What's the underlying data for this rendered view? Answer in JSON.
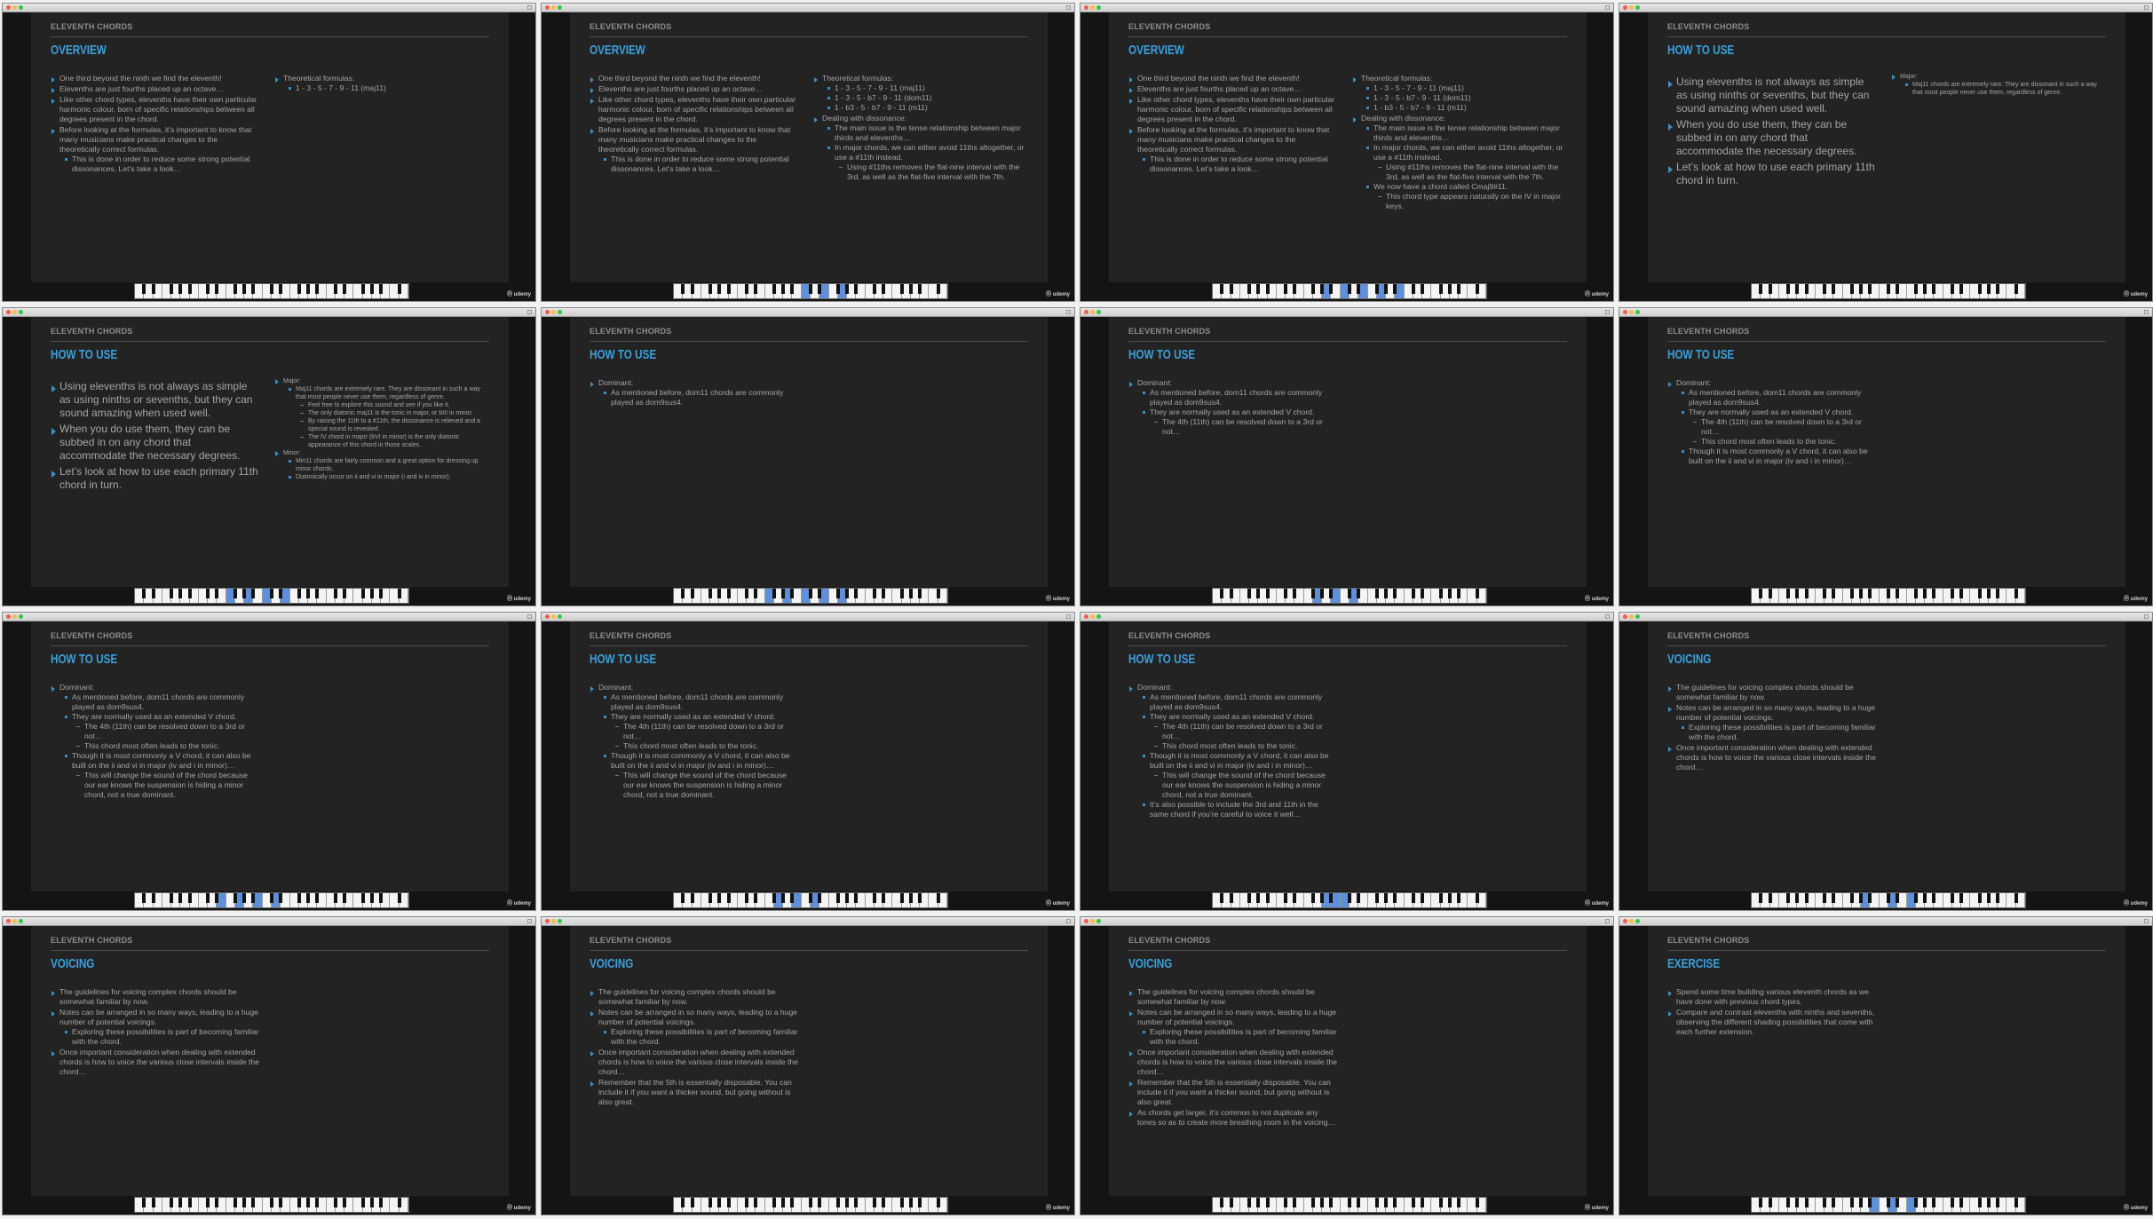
{
  "logo_text": "Ⓞ udemy",
  "frames": [
    {
      "title": "ELEVENTH CHORDS",
      "heading": "OVERVIEW",
      "left_size": "s",
      "right_size": "s",
      "left": [
        {
          "level": 0,
          "text": "One third beyond the ninth we find the eleventh!"
        },
        {
          "level": 0,
          "text": "Elevenths are just fourths placed up an octave…"
        },
        {
          "level": 0,
          "text": "Like other chord types, elevenths have their own particular harmonic colour, born of specific relationships between all degrees present in the chord."
        },
        {
          "level": 0,
          "text": "Before looking at the formulas, it’s important to know that many musicians make practical changes to the theoretically correct formulas."
        },
        {
          "level": 1,
          "text": "This is done in order to reduce some strong potential dissonances. Let’s take a look…"
        }
      ],
      "right": [
        {
          "level": 0,
          "text": "Theoretical formulas:"
        },
        {
          "level": 1,
          "text": "1 - 3 - 5 - 7 - 9 - 11 (maj11)"
        }
      ],
      "keys": []
    },
    {
      "title": "ELEVENTH CHORDS",
      "heading": "OVERVIEW",
      "left_size": "s",
      "right_size": "s",
      "left": [
        {
          "level": 0,
          "text": "One third beyond the ninth we find the eleventh!"
        },
        {
          "level": 0,
          "text": "Elevenths are just fourths placed up an octave…"
        },
        {
          "level": 0,
          "text": "Like other chord types, elevenths have their own particular harmonic colour, born of specific relationships between all degrees present in the chord."
        },
        {
          "level": 0,
          "text": "Before looking at the formulas, it’s important to know that many musicians make practical changes to the theoretically correct formulas."
        },
        {
          "level": 1,
          "text": "This is done in order to reduce some strong potential dissonances. Let’s take a look…"
        }
      ],
      "right": [
        {
          "level": 0,
          "text": "Theoretical formulas:"
        },
        {
          "level": 1,
          "text": "1 - 3 - 5 - 7 - 9 - 11 (maj11)"
        },
        {
          "level": 1,
          "text": "1 - 3 - 5 - b7 - 9 - 11 (dom11)"
        },
        {
          "level": 1,
          "text": "1 - b3 - 5 - b7 - 9 - 11 (m11)"
        },
        {
          "level": 0,
          "text": "Dealing with dissonance:"
        },
        {
          "level": 1,
          "text": "The main issue is the tense relationship between major thirds and elevenths…"
        },
        {
          "level": 1,
          "text": "In major chords, we can either avoid 11ths altogether, or use a #11th instead."
        },
        {
          "level": 2,
          "text": "Using #11ths removes the flat-nine interval with the 3rd, as well as the flat-five interval with the 7th."
        }
      ],
      "keys": [
        14,
        16,
        18
      ]
    },
    {
      "title": "ELEVENTH CHORDS",
      "heading": "OVERVIEW",
      "left_size": "s",
      "right_size": "s",
      "left": [
        {
          "level": 0,
          "text": "One third beyond the ninth we find the eleventh!"
        },
        {
          "level": 0,
          "text": "Elevenths are just fourths placed up an octave…"
        },
        {
          "level": 0,
          "text": "Like other chord types, elevenths have their own particular harmonic colour, born of specific relationships between all degrees present in the chord."
        },
        {
          "level": 0,
          "text": "Before looking at the formulas, it’s important to know that many musicians make practical changes to the theoretically correct formulas."
        },
        {
          "level": 1,
          "text": "This is done in order to reduce some strong potential dissonances. Let’s take a look…"
        }
      ],
      "right": [
        {
          "level": 0,
          "text": "Theoretical formulas:"
        },
        {
          "level": 1,
          "text": "1 - 3 - 5 - 7 - 9 - 11 (maj11)"
        },
        {
          "level": 1,
          "text": "1 - 3 - 5 - b7 - 9 - 11 (dom11)"
        },
        {
          "level": 1,
          "text": "1 - b3 - 5 - b7 - 9 - 11 (m11)"
        },
        {
          "level": 0,
          "text": "Dealing with dissonance:"
        },
        {
          "level": 1,
          "text": "The main issue is the tense relationship between major thirds and elevenths…"
        },
        {
          "level": 1,
          "text": "In major chords, we can either avoid 11ths altogether, or use a #11th instead."
        },
        {
          "level": 2,
          "text": "Using #11ths removes the flat-nine interval with the 3rd, as well as the flat-five interval with the 7th."
        },
        {
          "level": 1,
          "text": "We now have a chord called Cmaj9#11."
        },
        {
          "level": 2,
          "text": "This chord type appears naturally on the IV in major keys."
        }
      ],
      "keys": [
        12,
        14,
        16,
        18,
        20
      ]
    },
    {
      "title": "ELEVENTH CHORDS",
      "heading": "HOW TO USE",
      "left_size": "l",
      "right_size": "xs",
      "left": [
        {
          "level": 0,
          "text": "Using elevenths is not always as simple as using ninths or sevenths, but they can sound amazing when used well."
        },
        {
          "level": 0,
          "text": "When you do use them, they can be subbed in on any chord that accommodate the necessary degrees."
        },
        {
          "level": 0,
          "text": "Let’s look at how to use each primary 11th chord in turn."
        }
      ],
      "right": [
        {
          "level": 0,
          "text": "Major:"
        },
        {
          "level": 1,
          "text": "Maj11 chords are extremely rare. They are dissonant in such a way that most people never use them, regardless of genre."
        }
      ],
      "keys": []
    },
    {
      "title": "ELEVENTH CHORDS",
      "heading": "HOW TO USE",
      "left_size": "l",
      "right_size": "xs",
      "left": [
        {
          "level": 0,
          "text": "Using elevenths is not always as simple as using ninths or sevenths, but they can sound amazing when used well."
        },
        {
          "level": 0,
          "text": "When you do use them, they can be subbed in on any chord that accommodate the necessary degrees."
        },
        {
          "level": 0,
          "text": "Let’s look at how to use each primary 11th chord in turn."
        }
      ],
      "right": [
        {
          "level": 0,
          "text": "Major:"
        },
        {
          "level": 1,
          "text": "Maj11 chords are extremely rare. They are dissonant in such a way that most people never use them, regardless of genre."
        },
        {
          "level": 2,
          "text": "Feel free to explore this sound and see if you like it."
        },
        {
          "level": 2,
          "text": "The only diatonic maj11 is the tonic in major, or bIII in minor."
        },
        {
          "level": 2,
          "text": "By raising the 11th to a #11th, the dissonance is relieved and a special sound is revealed."
        },
        {
          "level": 2,
          "text": "The IV chord in major (bVI in minor) is the only diatonic appearance of this chord in those scales."
        },
        {
          "level": 0,
          "text": "Minor:"
        },
        {
          "level": 1,
          "text": "Min11 chords are fairly common and a great option for dressing up minor chords."
        },
        {
          "level": 1,
          "text": "Diatonically occur on ii and vi in major (i and iv in minor)."
        }
      ],
      "keys": [
        10,
        12,
        14,
        16
      ]
    },
    {
      "title": "ELEVENTH CHORDS",
      "heading": "HOW TO USE",
      "left_size": "s",
      "right_size": "s",
      "left": [
        {
          "level": 0,
          "text": "Dominant:"
        },
        {
          "level": 1,
          "text": "As mentioned before, dom11 chords are commonly played as dom9sus4."
        }
      ],
      "right": [],
      "keys": [
        10,
        12,
        14,
        16,
        18
      ]
    },
    {
      "title": "ELEVENTH CHORDS",
      "heading": "HOW TO USE",
      "left_size": "s",
      "right_size": "s",
      "left": [
        {
          "level": 0,
          "text": "Dominant:"
        },
        {
          "level": 1,
          "text": "As mentioned before, dom11 chords are commonly played as dom9sus4."
        },
        {
          "level": 1,
          "text": "They are normally used as an extended V chord."
        },
        {
          "level": 2,
          "text": "The 4th (11th) can be resolved down to a 3rd or not…"
        }
      ],
      "right": [],
      "keys": [
        11,
        13,
        15
      ]
    },
    {
      "title": "ELEVENTH CHORDS",
      "heading": "HOW TO USE",
      "left_size": "s",
      "right_size": "s",
      "left": [
        {
          "level": 0,
          "text": "Dominant:"
        },
        {
          "level": 1,
          "text": "As mentioned before, dom11 chords are commonly played as dom9sus4."
        },
        {
          "level": 1,
          "text": "They are normally used as an extended V chord."
        },
        {
          "level": 2,
          "text": "The 4th (11th) can be resolved down to a 3rd or not…"
        },
        {
          "level": 2,
          "text": "This chord most often leads to the tonic."
        },
        {
          "level": 1,
          "text": "Though it is most commonly a V chord, it can also be built on the ii and vi in major (iv and i in minor)…"
        }
      ],
      "right": [],
      "keys": []
    },
    {
      "title": "ELEVENTH CHORDS",
      "heading": "HOW TO USE",
      "left_size": "s",
      "right_size": "s",
      "left": [
        {
          "level": 0,
          "text": "Dominant:"
        },
        {
          "level": 1,
          "text": "As mentioned before, dom11 chords are commonly played as dom9sus4."
        },
        {
          "level": 1,
          "text": "They are normally used as an extended V chord."
        },
        {
          "level": 2,
          "text": "The 4th (11th) can be resolved down to a 3rd or not…"
        },
        {
          "level": 2,
          "text": "This chord most often leads to the tonic."
        },
        {
          "level": 1,
          "text": "Though it is most commonly a V chord, it can also be built on the ii and vi in major (iv and i in minor)…"
        },
        {
          "level": 2,
          "text": "This will change the sound of the chord because our ear knows the suspension is hiding a minor chord, not a true dominant."
        }
      ],
      "right": [],
      "keys": [
        9,
        11,
        13,
        15
      ]
    },
    {
      "title": "ELEVENTH CHORDS",
      "heading": "HOW TO USE",
      "left_size": "s",
      "right_size": "s",
      "left": [
        {
          "level": 0,
          "text": "Dominant:"
        },
        {
          "level": 1,
          "text": "As mentioned before, dom11 chords are commonly played as dom9sus4."
        },
        {
          "level": 1,
          "text": "They are normally used as an extended V chord."
        },
        {
          "level": 2,
          "text": "The 4th (11th) can be resolved down to a 3rd or not…"
        },
        {
          "level": 2,
          "text": "This chord most often leads to the tonic."
        },
        {
          "level": 1,
          "text": "Though it is most commonly a V chord, it can also be built on the ii and vi in major (iv and i in minor)…"
        },
        {
          "level": 2,
          "text": "This will change the sound of the chord because our ear knows the suspension is hiding a minor chord, not a true dominant."
        }
      ],
      "right": [],
      "keys": [
        11,
        13,
        15
      ]
    },
    {
      "title": "ELEVENTH CHORDS",
      "heading": "HOW TO USE",
      "left_size": "s",
      "right_size": "s",
      "left": [
        {
          "level": 0,
          "text": "Dominant:"
        },
        {
          "level": 1,
          "text": "As mentioned before, dom11 chords are commonly played as dom9sus4."
        },
        {
          "level": 1,
          "text": "They are normally used as an extended V chord."
        },
        {
          "level": 2,
          "text": "The 4th (11th) can be resolved down to a 3rd or not…"
        },
        {
          "level": 2,
          "text": "This chord most often leads to the tonic."
        },
        {
          "level": 1,
          "text": "Though it is most commonly a V chord, it can also be built on the ii and vi in major (iv and i in minor)…"
        },
        {
          "level": 2,
          "text": "This will change the sound of the chord because our ear knows the suspension is hiding a minor chord, not a true dominant."
        },
        {
          "level": 1,
          "text": "It’s also possible to include the 3rd and 11th in the same chord if you’re careful to voice it well…"
        }
      ],
      "right": [],
      "keys": [
        12,
        13,
        14
      ]
    },
    {
      "title": "ELEVENTH CHORDS",
      "heading": "VOICING",
      "left_size": "s",
      "right_size": "s",
      "left": [
        {
          "level": 0,
          "text": "The guidelines for voicing complex chords should be somewhat familiar by now."
        },
        {
          "level": 0,
          "text": "Notes can be arranged in so many ways, leading to a huge number of potential voicings."
        },
        {
          "level": 1,
          "text": "Exploring these possibilities is part of becoming familiar with the chord."
        },
        {
          "level": 0,
          "text": "Once important consideration when dealing with extended chords is how to voice the various close intervals inside the chord…"
        }
      ],
      "right": [],
      "keys": [
        12,
        15,
        17
      ]
    },
    {
      "title": "ELEVENTH CHORDS",
      "heading": "VOICING",
      "left_size": "s",
      "right_size": "s",
      "left": [
        {
          "level": 0,
          "text": "The guidelines for voicing complex chords should be somewhat familiar by now."
        },
        {
          "level": 0,
          "text": "Notes can be arranged in so many ways, leading to a huge number of potential voicings."
        },
        {
          "level": 1,
          "text": "Exploring these possibilities is part of becoming familiar with the chord."
        },
        {
          "level": 0,
          "text": "Once important consideration when dealing with extended chords is how to voice the various close intervals inside the chord…"
        }
      ],
      "right": [],
      "keys": []
    },
    {
      "title": "ELEVENTH CHORDS",
      "heading": "VOICING",
      "left_size": "s",
      "right_size": "s",
      "left": [
        {
          "level": 0,
          "text": "The guidelines for voicing complex chords should be somewhat familiar by now."
        },
        {
          "level": 0,
          "text": "Notes can be arranged in so many ways, leading to a huge number of potential voicings."
        },
        {
          "level": 1,
          "text": "Exploring these possibilities is part of becoming familiar with the chord."
        },
        {
          "level": 0,
          "text": "Once important consideration when dealing with extended chords is how to voice the various close intervals inside the chord…"
        },
        {
          "level": 0,
          "text": "Remember that the 5th is essentially disposable. You can include it if you want a thicker sound, but going without is also great."
        }
      ],
      "right": [],
      "keys": []
    },
    {
      "title": "ELEVENTH CHORDS",
      "heading": "VOICING",
      "left_size": "s",
      "right_size": "s",
      "left": [
        {
          "level": 0,
          "text": "The guidelines for voicing complex chords should be somewhat familiar by now."
        },
        {
          "level": 0,
          "text": "Notes can be arranged in so many ways, leading to a huge number of potential voicings."
        },
        {
          "level": 1,
          "text": "Exploring these possibilities is part of becoming familiar with the chord."
        },
        {
          "level": 0,
          "text": "Once important consideration when dealing with extended chords is how to voice the various close intervals inside the chord…"
        },
        {
          "level": 0,
          "text": "Remember that the 5th is essentially disposable. You can include it if you want a thicker sound, but going without is also great."
        },
        {
          "level": 0,
          "text": "As chords get larger, it’s common to not duplicate any tones so as to create more breathing room in the voicing…"
        }
      ],
      "right": [],
      "keys": []
    },
    {
      "title": "ELEVENTH CHORDS",
      "heading": "EXERCISE",
      "left_size": "s",
      "right_size": "s",
      "left": [
        {
          "level": 0,
          "text": "Spend some time building various eleventh chords as we have done with previous chord types."
        },
        {
          "level": 0,
          "text": "Compare and contrast elevenths with ninths and sevenths, observing the different shading possibilities that come with each further extension."
        }
      ],
      "right": [],
      "keys": [
        13,
        15,
        17
      ]
    }
  ]
}
